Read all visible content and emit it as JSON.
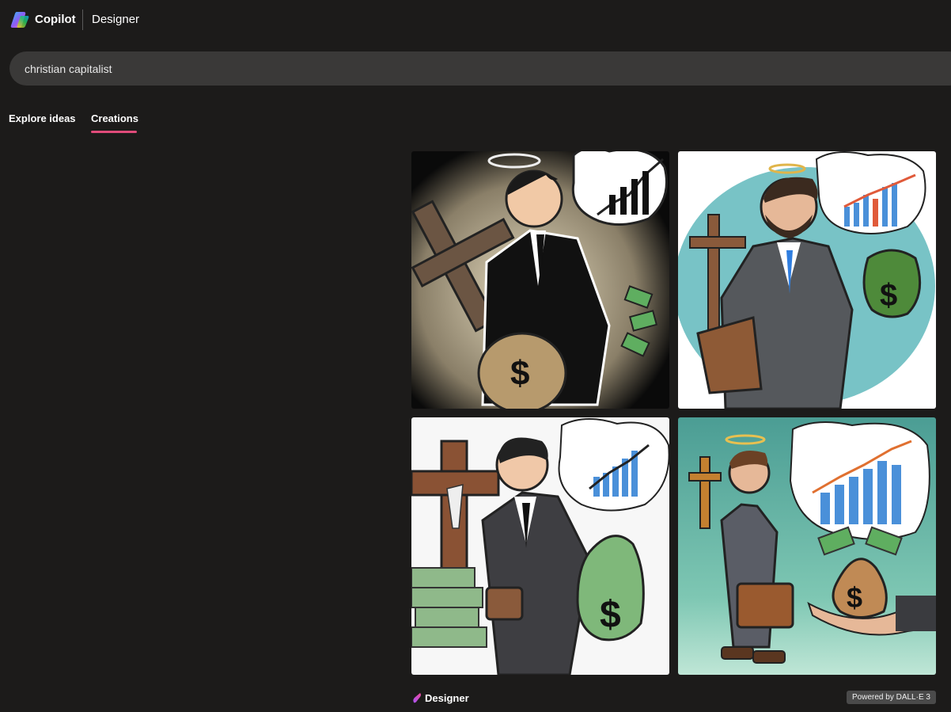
{
  "header": {
    "brand": "Copilot",
    "product": "Designer",
    "logo_icon": "copilot-logo-icon"
  },
  "search": {
    "value": "christian capitalist",
    "placeholder": ""
  },
  "tabs": [
    {
      "label": "Explore ideas",
      "active": false
    },
    {
      "label": "Creations",
      "active": true
    }
  ],
  "colors": {
    "background": "#1c1b1a",
    "search_bg": "#3a3938",
    "tab_accent": "#e04b7a",
    "badge_bg": "#4a4a4a"
  },
  "images": [
    {
      "name": "generated-image-1",
      "theme": "dark"
    },
    {
      "name": "generated-image-2",
      "theme": "teal"
    },
    {
      "name": "generated-image-3",
      "theme": "white"
    },
    {
      "name": "generated-image-4",
      "theme": "green"
    }
  ],
  "footer": {
    "brand": "Designer",
    "brand_icon": "designer-logo-icon",
    "powered_by": "Powered by DALL·E 3"
  }
}
